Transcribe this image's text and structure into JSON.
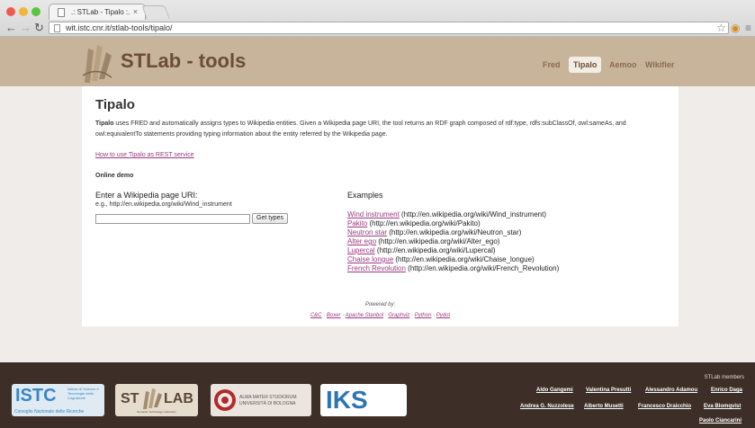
{
  "browser": {
    "tab_title": ".: STLab - Tipalo :.",
    "tab_close": "×",
    "url": "wit.istc.cnr.it/stlab-tools/tipalo/"
  },
  "header": {
    "brand": "STLab - tools",
    "nav": [
      "Fred",
      "Tipalo",
      "Aemoo",
      "Wikifier"
    ],
    "active_nav": "Tipalo"
  },
  "main": {
    "title": "Tipalo",
    "desc_bold": "Tipalo",
    "description": " uses FRED and automatically assigns types to Wikipedia entities. Given a Wikipedia page URI, the tool returns an RDF graph composed of rdf:type, rdfs:subClassOf, owl:sameAs, and owl:equivalentTo statements providing typing information about the entity referred by the Wikipedia page.",
    "rest_link": "How to use Tipalo as REST service",
    "demo_heading": "Online demo",
    "enter_label": "Enter a Wikipedia page URI:",
    "example_hint": "e.g., http://en.wikipedia.org/wiki/Wind_instrument",
    "input_value": "",
    "button_label": "Get types",
    "examples_heading": "Examples",
    "examples": [
      {
        "name": "Wind instrument",
        "url": "(http://en.wikipedia.org/wiki/Wind_instrument)"
      },
      {
        "name": "Pakito",
        "url": "(http://en.wikipedia.org/wiki/Pakito)"
      },
      {
        "name": "Neutron star",
        "url": "(http://en.wikipedia.org/wiki/Neutron_star)"
      },
      {
        "name": "Alter ego",
        "url": "(http://en.wikipedia.org/wiki/Alter_ego)"
      },
      {
        "name": "Lupercal",
        "url": "(http://en.wikipedia.org/wiki/Lupercal)"
      },
      {
        "name": "Chaise longue",
        "url": "(http://en.wikipedia.org/wiki/Chaise_longue)"
      },
      {
        "name": "French Revolution",
        "url": "(http://en.wikipedia.org/wiki/French_Revolution)"
      }
    ],
    "powered_by": "Powered by:",
    "tech": [
      "C&C",
      "Boxer",
      "Apache Stanbol",
      "Graphviz",
      "Python",
      "Pydot"
    ],
    "tech_sep": " · "
  },
  "footer": {
    "logos": [
      "ISTC",
      "Istituto di Scienze e Tecnologie della Cognizione",
      "Consiglio Nazionale delle Ricerche",
      "ST",
      "LAB",
      "Semantic Technology Laboratory",
      "ALMA MATER STUDIORUM",
      "UNIVERSITÀ DI BOLOGNA",
      "IKS"
    ],
    "members_heading": "STLab members",
    "members_row1": [
      "Aldo Gangemi",
      "Valentina Presutti",
      "Alessandro Adamou",
      "Enrico Daga"
    ],
    "members_row2": [
      "Andrea G. Nuzzolese",
      "Alberto Musetti",
      "Francesco Draicchio",
      "Eva Blomqvist"
    ],
    "members_row3": [
      "Paolo Ciancarini"
    ]
  },
  "colors": {
    "header_bg": "#c8b49a",
    "brand": "#6a4e36",
    "link": "#9b3b83",
    "footer_bg": "#3d2f28"
  }
}
